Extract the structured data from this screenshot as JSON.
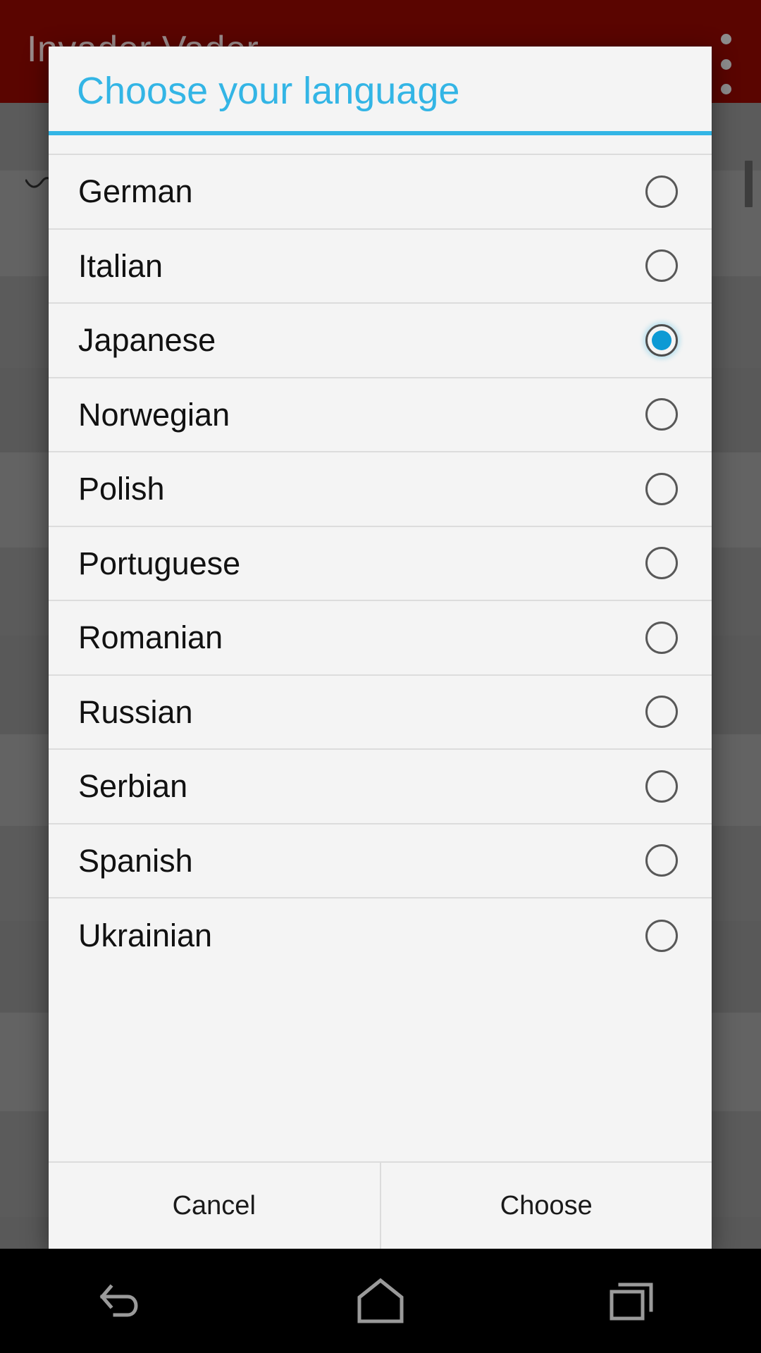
{
  "app": {
    "title": "Invader Vader",
    "action_bar_color": "#5a0500",
    "overflow_icon": "overflow-menu-icon"
  },
  "dialog": {
    "title": "Choose your language",
    "accent_color": "#33b5e5",
    "background_color": "#f4f4f4",
    "items": [
      {
        "label": "German",
        "selected": false
      },
      {
        "label": "Italian",
        "selected": false
      },
      {
        "label": "Japanese",
        "selected": true
      },
      {
        "label": "Norwegian",
        "selected": false
      },
      {
        "label": "Polish",
        "selected": false
      },
      {
        "label": "Portuguese",
        "selected": false
      },
      {
        "label": "Romanian",
        "selected": false
      },
      {
        "label": "Russian",
        "selected": false
      },
      {
        "label": "Serbian",
        "selected": false
      },
      {
        "label": "Spanish",
        "selected": false
      },
      {
        "label": "Ukrainian",
        "selected": false
      }
    ],
    "buttons": {
      "cancel": "Cancel",
      "choose": "Choose"
    }
  },
  "navigation_bar": {
    "back": "back-icon",
    "home": "home-icon",
    "recents": "recents-icon"
  }
}
